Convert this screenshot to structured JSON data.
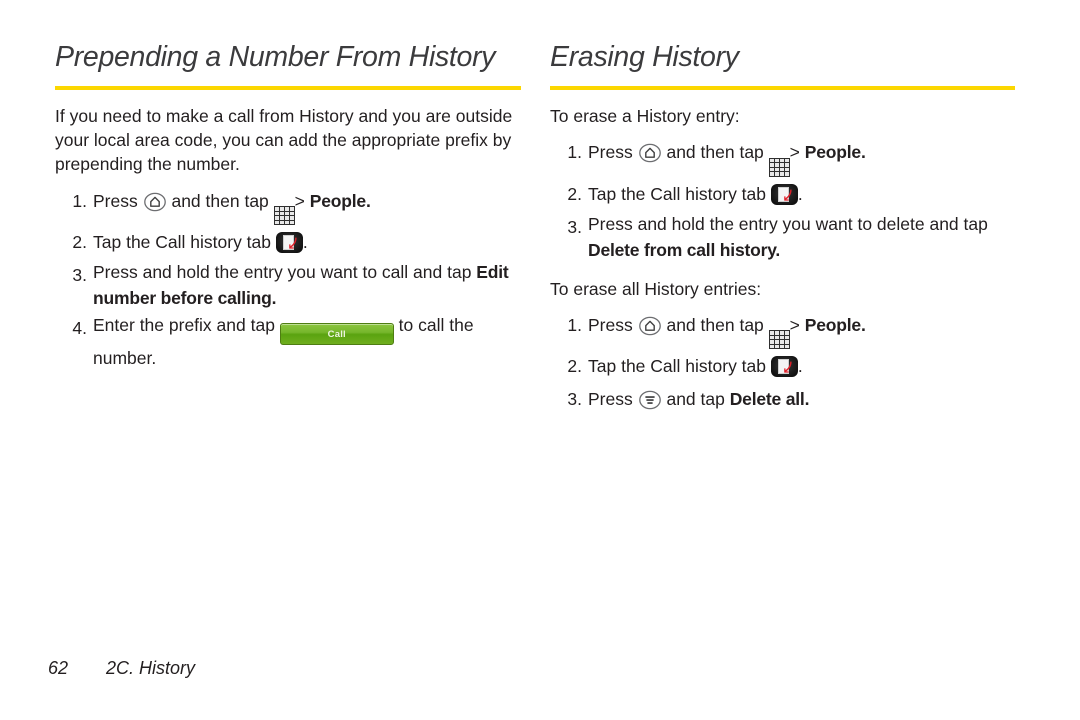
{
  "document": {
    "accent_color": "#fcd700",
    "text_color": "#231f20",
    "heading_color": "#3b3b3d",
    "call_button_color": "#76b62c"
  },
  "left_column": {
    "heading": "Prepending a Number From History",
    "intro": "If you need to make a call from History and you are outside your local area code, you can add the appropriate prefix by prepending the number.",
    "steps": [
      {
        "number": "1.",
        "text_before_home_icon": "Press ",
        "text_after_home_icon": " and then tap ",
        "separator": ">",
        "bold_target": "People.",
        "icons": [
          "home-key-icon",
          "apps-grid-icon"
        ]
      },
      {
        "number": "2.",
        "text": "Tap the Call history tab ",
        "trailing": ".",
        "icons": [
          "call-history-tab-icon"
        ]
      },
      {
        "number": "3.",
        "text": "Press and hold the entry you want to call and tap ",
        "bold_target": "Edit number before calling.",
        "icons": []
      },
      {
        "number": "4.",
        "text_before_button": "Enter the prefix and tap ",
        "button_label": "Call",
        "text_after_button": " to call the number.",
        "icons": [
          "call-button"
        ]
      }
    ]
  },
  "right_column": {
    "heading": "Erasing History",
    "section_one": {
      "lead": "To erase a History entry:",
      "steps": [
        {
          "number": "1.",
          "text_before_home_icon": "Press ",
          "text_after_home_icon": " and then tap ",
          "separator": ">",
          "bold_target": "People.",
          "icons": [
            "home-key-icon",
            "apps-grid-icon"
          ]
        },
        {
          "number": "2.",
          "text": "Tap the Call history tab ",
          "trailing": ".",
          "icons": [
            "call-history-tab-icon"
          ]
        },
        {
          "number": "3.",
          "text": "Press and hold the entry you want to delete and tap ",
          "bold_target": "Delete from call history.",
          "icons": []
        }
      ]
    },
    "section_two": {
      "lead": "To erase all History entries:",
      "steps": [
        {
          "number": "1.",
          "text_before_home_icon": "Press ",
          "text_after_home_icon": " and then tap ",
          "separator": ">",
          "bold_target": "People.",
          "icons": [
            "home-key-icon",
            "apps-grid-icon"
          ]
        },
        {
          "number": "2.",
          "text": "Tap the Call history tab ",
          "trailing": ".",
          "icons": [
            "call-history-tab-icon"
          ]
        },
        {
          "number": "3.",
          "text_before_menu_icon": "Press ",
          "text_after_menu_icon": " and tap ",
          "bold_target": "Delete all.",
          "icons": [
            "menu-key-icon"
          ]
        }
      ]
    }
  },
  "footer": {
    "page_number": "62",
    "chapter": "2C. History"
  }
}
